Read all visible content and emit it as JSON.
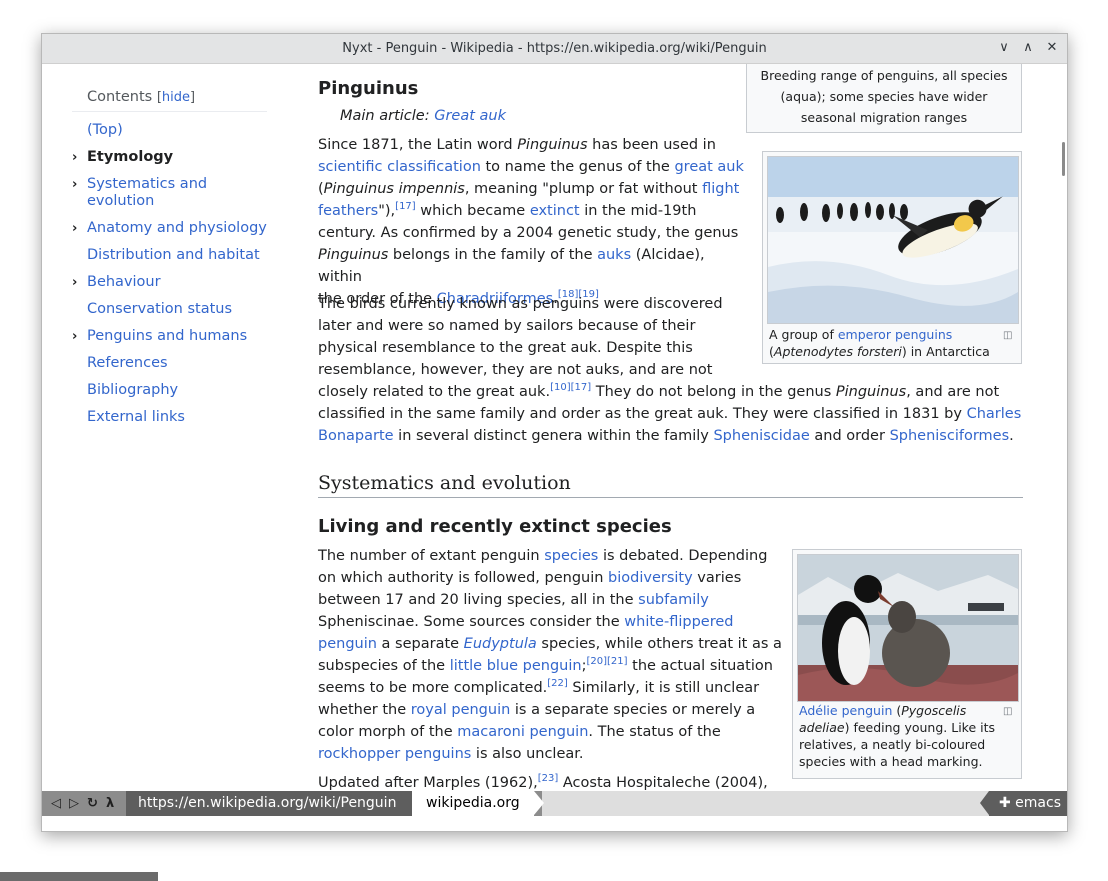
{
  "window": {
    "title": "Nyxt - Penguin - Wikipedia - https://en.wikipedia.org/wiki/Penguin",
    "controls": {
      "minimize": "∨",
      "maximize": "∧",
      "close": "✕"
    }
  },
  "toc": {
    "heading": "Contents",
    "hide_open": "[",
    "hide_label": "hide",
    "hide_close": "]",
    "items": [
      {
        "label": "(Top)"
      },
      {
        "label": "Etymology"
      },
      {
        "label": "Systematics and evolution"
      },
      {
        "label": "Anatomy and physiology"
      },
      {
        "label": "Distribution and habitat"
      },
      {
        "label": "Behaviour"
      },
      {
        "label": "Conservation status"
      },
      {
        "label": "Penguins and humans"
      },
      {
        "label": "References"
      },
      {
        "label": "Bibliography"
      },
      {
        "label": "External links"
      }
    ],
    "expander": "›"
  },
  "article": {
    "top_caption": "Breeding range of penguins, all species (aqua); some species have wider seasonal migration ranges",
    "pinguinus_heading": "Pinguinus",
    "hatnote_prefix": "Main article: ",
    "hatnote_link": "Great auk",
    "p1": {
      "t1": "Since 1871, the Latin word ",
      "i1": "Pinguinus",
      "t2": " has been used in",
      "l1": "scientific classification",
      "t3": " to name the genus of the ",
      "l2": "great auk",
      "t4": "(",
      "i2": "Pinguinus impennis",
      "t5": ", meaning \"plump or fat without ",
      "l3a": "flight",
      "l3b": "feathers",
      "t6": "\"),",
      "r1": "[17]",
      "t7": " which became ",
      "l4": "extinct",
      "t8": " in the mid-19th",
      "t9": "century. As confirmed by a 2004 genetic study, the genus",
      "i3": "Pinguinus",
      "t10": " belongs in the family of the ",
      "l5": "auks",
      "t11": " (Alcidae), within",
      "t12": "the order of the ",
      "l6": "Charadriiformes",
      "t13": ".",
      "r2": "[18][19]"
    },
    "p2": {
      "line1": "The birds currently known as penguins were discovered",
      "line2": "later and were so named by sailors because of their",
      "line3": "physical resemblance to the great auk. Despite this",
      "line4": "resemblance, however, they are not auks, and are not",
      "t1": "closely related to the great auk.",
      "r1": "[10][17]",
      "t2": " They do not belong in the genus ",
      "i1": "Pinguinus",
      "t3": ", and are not",
      "line6": "classified in the same family and order as the great auk. They were classified in 1831 by ",
      "l1a": "Charles",
      "l1b": "Bonaparte",
      "t4": " in several distinct genera within the family ",
      "l2": "Spheniscidae",
      "t5": " and order ",
      "l3": "Sphenisciformes",
      "t6": "."
    },
    "emperor_thumb": {
      "cap_t1": "A group of ",
      "cap_link": "emperor penguins",
      "cap_t2": "(",
      "cap_i": "Aptenodytes forsteri",
      "cap_t3": ") in Antarctica"
    },
    "h2": "Systematics and evolution",
    "h3": "Living and recently extinct species",
    "p3": {
      "t1": "The number of extant penguin ",
      "l1": "species",
      "t2": " is debated. Depending",
      "t3": "on which authority is followed, penguin ",
      "l2": "biodiversity",
      "t4": " varies",
      "t5": "between 17 and 20 living species, all in the ",
      "l3": "subfamily",
      "t6": "Spheniscinae. Some sources consider the ",
      "l4a": "white-flippered",
      "l4b": "penguin",
      "t7": " a separate ",
      "l5": "Eudyptula",
      "t8": " species, while others treat it as a",
      "t9": "subspecies of the ",
      "l6": "little blue penguin",
      "t10": ";",
      "r1": "[20][21]",
      "t11": " the actual situation",
      "t12": "seems to be more complicated.",
      "r2": "[22]",
      "t13": " Similarly, it is still unclear",
      "t14": "whether the ",
      "l7": "royal penguin",
      "t15": " is a separate species or merely a",
      "t16": "color morph of the ",
      "l8": "macaroni penguin",
      "t17": ". The status of the",
      "l9": "rockhopper penguins",
      "t18": " is also unclear."
    },
    "p4": {
      "t1": "Updated after Marples (1962),",
      "r1": "[23]",
      "t2": " Acosta Hospitaleche (2004),"
    },
    "adelie_thumb": {
      "cap_link": "Adélie penguin",
      "cap_t1": " (",
      "cap_i1": "Pygoscelis",
      "cap_i2": "adeliae",
      "cap_t2": ") feeding young. Like its",
      "cap_t3": "relatives, a neatly bi-coloured",
      "cap_t4": "species with a head marking."
    }
  },
  "statusbar": {
    "back": "◁",
    "forward": "▷",
    "reload": "↻",
    "lambda": "λ",
    "url": "https://en.wikipedia.org/wiki/Penguin",
    "domain": "wikipedia.org",
    "mode": "✚ emacs"
  }
}
